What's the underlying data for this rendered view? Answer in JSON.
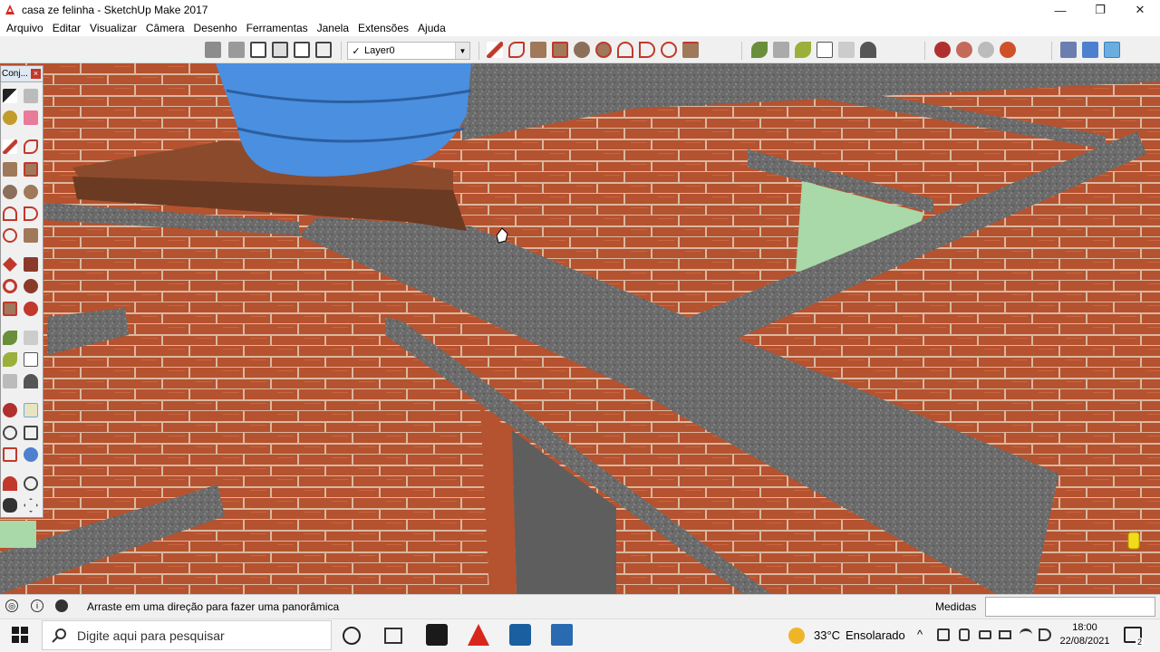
{
  "window": {
    "title": "casa ze felinha - SketchUp Make 2017",
    "controls": {
      "minimize": "—",
      "maximize": "❐",
      "close": "✕"
    }
  },
  "menu": [
    "Arquivo",
    "Editar",
    "Visualizar",
    "Câmera",
    "Desenho",
    "Ferramentas",
    "Janela",
    "Extensões",
    "Ajuda"
  ],
  "toolbar": {
    "layer_check": "✓",
    "layer_value": "Layer0",
    "layer_arrow": "▼"
  },
  "side_panel": {
    "title": "Conj...",
    "close": "×"
  },
  "status": {
    "hint": "Arraste em uma direção para fazer uma panorâmica",
    "measure_label": "Medidas",
    "measure_value": ""
  },
  "taskbar": {
    "search_placeholder": "Digite aqui para pesquisar",
    "temperature": "33°C",
    "weather": "Ensolarado",
    "time": "18:00",
    "date": "22/08/2021",
    "notification_count": "2"
  },
  "colors": {
    "brick": "#b5522f",
    "concrete": "#6e6e6e",
    "tank": "#4a8fe0",
    "wood": "#8b4a2b",
    "sky_panel": "#a9d8a9"
  }
}
